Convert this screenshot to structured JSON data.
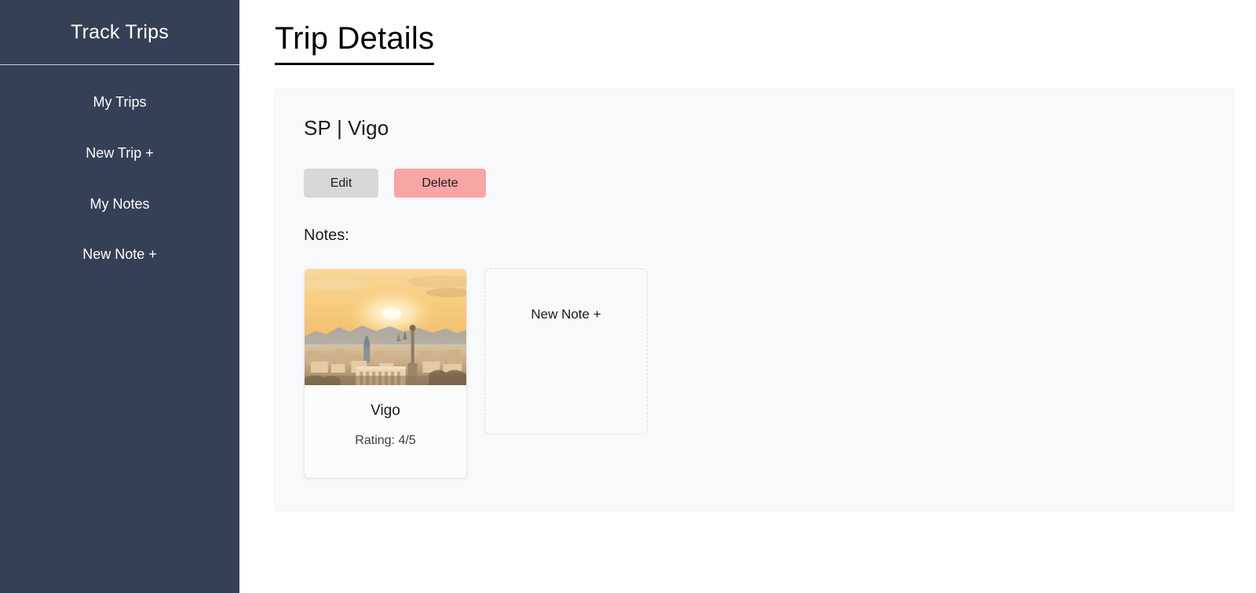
{
  "sidebar": {
    "brand": "Track Trips",
    "items": [
      {
        "label": "My Trips",
        "name": "my-trips"
      },
      {
        "label": "New Trip +",
        "name": "new-trip"
      },
      {
        "label": "My Notes",
        "name": "my-notes"
      },
      {
        "label": "New Note +",
        "name": "new-note"
      }
    ]
  },
  "main": {
    "page_title": "Trip Details",
    "trip": {
      "country_code": "SP",
      "separator": "|",
      "city": "Vigo"
    },
    "actions": {
      "edit_label": "Edit",
      "delete_label": "Delete"
    },
    "notes_label": "Notes:",
    "notes": [
      {
        "title": "Vigo",
        "rating_label": "Rating: 4/5",
        "rating_value": "4/5",
        "image_alt": "sunset-cityscape-photo"
      }
    ],
    "new_note_label": "New Note +"
  },
  "colors": {
    "sidebar_bg": "#344055",
    "sidebar_text": "#ffffff",
    "sidebar_divider": "#ced4da",
    "page_bg": "#ffffff",
    "panel_bg": "#f8f9fa",
    "edit_button_bg": "#d6d8da",
    "delete_button_bg": "#f7a5a5",
    "text_primary": "#1b1b1b",
    "text_muted": "#3d3d3d",
    "card_bg": "#fcfcfd",
    "card_border": "#ececee",
    "dashed_border": "#dcdde0"
  }
}
